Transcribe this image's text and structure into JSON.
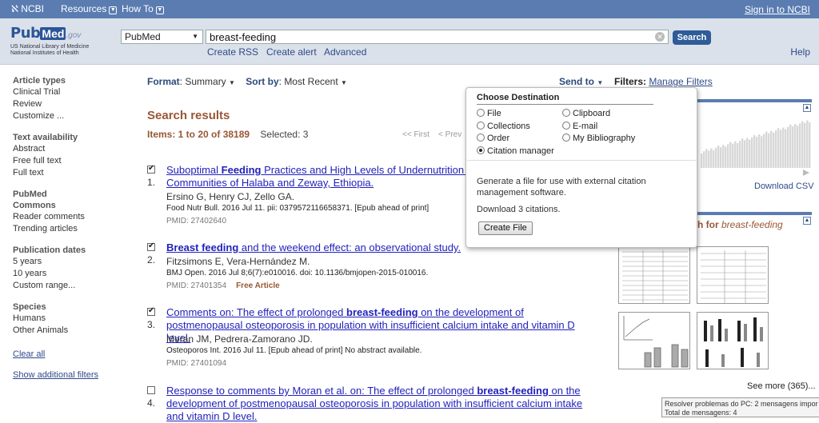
{
  "ncbi_bar": {
    "logo": "NCBI",
    "resources": "Resources",
    "howto": "How To",
    "signin": "Sign in to NCBI"
  },
  "header": {
    "logo_pub": "Pub",
    "logo_med": "Med",
    "logo_gov": ".gov",
    "logo_sub1": "US National Library of Medicine",
    "logo_sub2": "National Institutes of Health",
    "db_selected": "PubMed",
    "search_value": "breast-feeding",
    "search_button": "Search",
    "links": [
      "Create RSS",
      "Create alert",
      "Advanced"
    ],
    "help": "Help"
  },
  "sidebar": {
    "groups": [
      {
        "head": "Article types",
        "items": [
          "Clinical Trial",
          "Review",
          "Customize ..."
        ]
      },
      {
        "head": "Text availability",
        "items": [
          "Abstract",
          "Free full text",
          "Full text"
        ]
      },
      {
        "head": "PubMed Commons",
        "items": [
          "Reader comments",
          "Trending articles"
        ]
      },
      {
        "head": "Publication dates",
        "items": [
          "5 years",
          "10 years",
          "Custom range..."
        ]
      },
      {
        "head": "Species",
        "items": [
          "Humans",
          "Other Animals"
        ]
      }
    ],
    "clear_all": "Clear all",
    "show_filters": "Show additional filters"
  },
  "toolbar": {
    "format_label": "Format",
    "format_value": "Summary",
    "sort_label": "Sort by",
    "sort_value": "Most Recent",
    "sendto": "Send to",
    "filters_label": "Filters:",
    "manage_filters": "Manage Filters"
  },
  "results": {
    "title": "Search results",
    "items_label": "Items: 1 to 20 of 38189",
    "selected": "Selected: 3",
    "pager_first": "<< First",
    "pager_prev": "< Prev",
    "list": [
      {
        "num": "1.",
        "checked": true,
        "title_parts": [
          [
            "Suboptimal ",
            false
          ],
          [
            "Feeding",
            true
          ],
          [
            " Practices and High Levels of Undernutrition Am",
            false
          ],
          [
            "ong",
            false
          ],
          [
            " Children in the Rural Communities of Halaba and Zeway, Ethiopia.",
            false
          ]
        ],
        "authors": "Ersino G, Henry CJ, Zello GA.",
        "journal": "Food Nutr Bull. 2016 Jul 11. pii: 0379572116658371. [Epub ahead of print]",
        "pmid": "PMID: 27402640",
        "free": ""
      },
      {
        "num": "2.",
        "checked": true,
        "title_parts": [
          [
            "Breast feeding",
            true
          ],
          [
            " and the weekend effect: an observational study.",
            false
          ]
        ],
        "authors": "Fitzsimons E, Vera-Hernández M.",
        "journal": "BMJ Open. 2016 Jul 8;6(7):e010016. doi: 10.1136/bmjopen-2015-010016.",
        "pmid": "PMID: 27401354",
        "free": "Free Article"
      },
      {
        "num": "3.",
        "checked": true,
        "title_parts": [
          [
            "Comments on: The effect of prolonged ",
            false
          ],
          [
            "breast-feeding",
            true
          ],
          [
            " on the development of postmenopausal osteoporosis in population with insufficient calcium intake and vitamin D level.",
            false
          ]
        ],
        "authors": "Moran JM, Pedrera-Zamorano JD.",
        "journal": "Osteoporos Int. 2016 Jul 11. [Epub ahead of print] No abstract available.",
        "pmid": "PMID: 27401094",
        "free": ""
      },
      {
        "num": "4.",
        "checked": false,
        "title_parts": [
          [
            "Response to comments by Moran et al. on: The effect of prolonged ",
            false
          ],
          [
            "breast-feeding",
            true
          ],
          [
            " on the development of postmenopausal osteoporosis in population with insufficient calcium intake and vitamin D level.",
            false
          ]
        ],
        "authors": "",
        "journal": "",
        "pmid": "",
        "free": ""
      }
    ]
  },
  "right": {
    "download_csv": "Download CSV",
    "pmc_title_prefix": "h for ",
    "pmc_title_term": "breast-feeding",
    "see_more": "See more (365)...",
    "tooltip_line1": "Resolver problemas do PC: 2 mensagens impor",
    "tooltip_line2": "Total de mensagens: 4"
  },
  "popup": {
    "title": "Choose Destination",
    "options_left": [
      "File",
      "Collections",
      "Order",
      "Citation manager"
    ],
    "options_right": [
      "Clipboard",
      "E-mail",
      "My Bibliography"
    ],
    "selected": "Citation manager",
    "description": "Generate a file for use with external citation management software.",
    "download_text": "Download 3 citations.",
    "button": "Create File"
  },
  "colors": {
    "ncbi_bar": "#5a7cb1",
    "header_bg": "#dbe1ea",
    "accent_brown": "#985735",
    "link": "#2f4a8a",
    "result_link": "#2222bb"
  }
}
